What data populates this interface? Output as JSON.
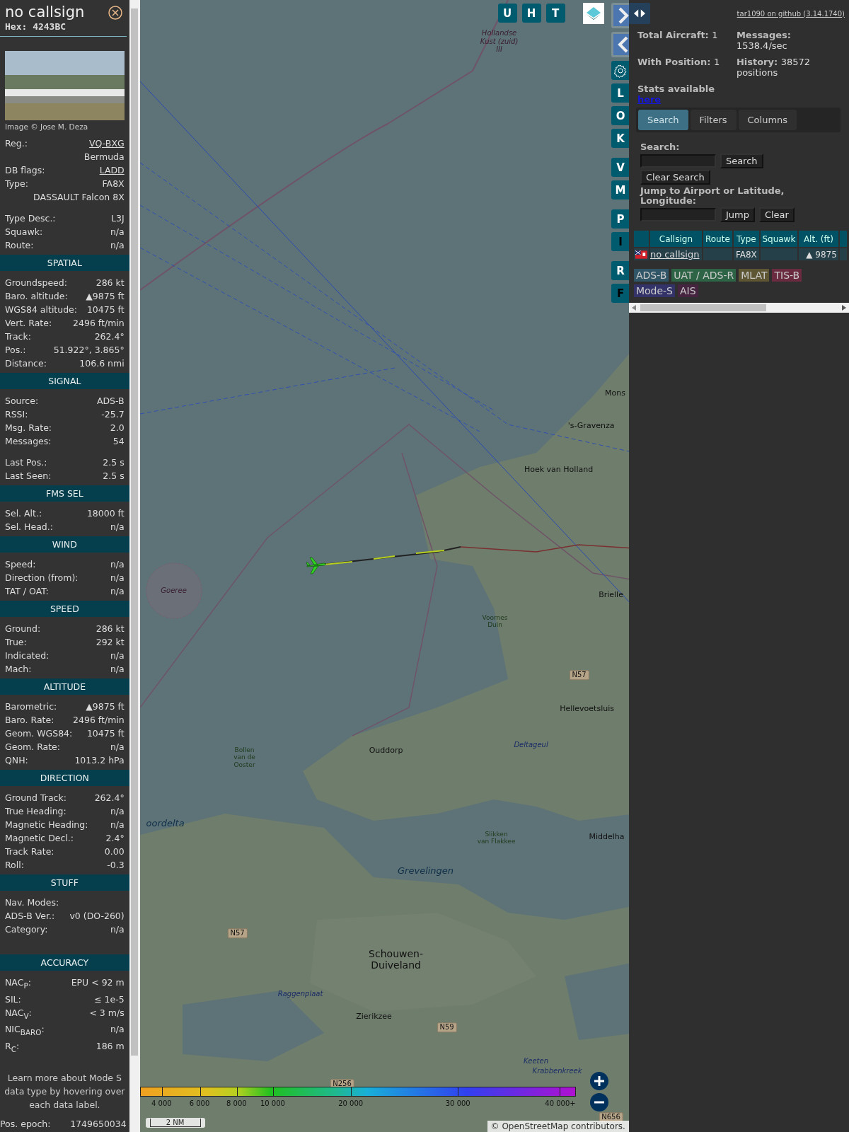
{
  "aircraft_panel": {
    "title": "no callsign",
    "hex": "Hex: 4243BC",
    "photo_credit": "Image © Jose M. Deza",
    "sections": [
      {
        "groups": [
          [
            {
              "label": "Reg.:",
              "value": "VQ-BXG",
              "link": true
            },
            {
              "value": "Bermuda",
              "link": false
            },
            {
              "label": "DB flags:",
              "value": "LADD",
              "link": true
            },
            {
              "label": "Type:",
              "value": "FA8X",
              "link": false
            },
            {
              "value": "DASSAULT Falcon 8X",
              "link": false
            }
          ],
          [
            {
              "label": "Type Desc.:",
              "value": "L3J",
              "link": false
            },
            {
              "label": "Squawk:",
              "value": "n/a",
              "link": false
            },
            {
              "label": "Route:",
              "value": "n/a",
              "link": false
            }
          ]
        ]
      },
      {
        "title": "SPATIAL",
        "groups": [
          [
            {
              "label": "Groundspeed:",
              "value": "286 kt",
              "link": false
            },
            {
              "label": "Baro. altitude:",
              "value": "▲9875 ft",
              "link": false
            },
            {
              "label": "WGS84 altitude:",
              "value": "10475 ft",
              "link": false
            },
            {
              "label": "Vert. Rate:",
              "value": "2496 ft/min",
              "link": false
            },
            {
              "label": "Track:",
              "value": "262.4°",
              "link": false
            },
            {
              "label": "Pos.:",
              "value": "51.922°, 3.865°",
              "link": false
            },
            {
              "label": "Distance:",
              "value": "106.6 nmi",
              "link": false
            }
          ]
        ]
      },
      {
        "title": "SIGNAL",
        "groups": [
          [
            {
              "label": "Source:",
              "value": "ADS-B",
              "link": false
            },
            {
              "label": "RSSI:",
              "value": "-25.7",
              "link": false
            },
            {
              "label": "Msg. Rate:",
              "value": "2.0",
              "link": false
            },
            {
              "label": "Messages:",
              "value": "54",
              "link": false
            }
          ],
          [
            {
              "label": "Last Pos.:",
              "value": "2.5 s",
              "link": false
            },
            {
              "label": "Last Seen:",
              "value": "2.5 s",
              "link": false
            }
          ]
        ]
      },
      {
        "title": "FMS SEL",
        "groups": [
          [
            {
              "label": "Sel. Alt.:",
              "value": "18000 ft",
              "link": false
            },
            {
              "label": "Sel. Head.:",
              "value": "n/a",
              "link": false
            }
          ]
        ]
      },
      {
        "title": "WIND",
        "groups": [
          [
            {
              "label": "Speed:",
              "value": "n/a",
              "link": false
            },
            {
              "label": "Direction (from):",
              "value": "n/a",
              "link": false
            },
            {
              "label": "TAT / OAT:",
              "value": "n/a",
              "link": false
            }
          ]
        ]
      },
      {
        "title": "SPEED",
        "groups": [
          [
            {
              "label": "Ground:",
              "value": "286 kt",
              "link": false
            },
            {
              "label": "True:",
              "value": "292 kt",
              "link": false
            },
            {
              "label": "Indicated:",
              "value": "n/a",
              "link": false
            },
            {
              "label": "Mach:",
              "value": "n/a",
              "link": false
            }
          ]
        ]
      },
      {
        "title": "ALTITUDE",
        "groups": [
          [
            {
              "label": "Barometric:",
              "value": "▲9875 ft",
              "link": false
            },
            {
              "label": "Baro. Rate:",
              "value": "2496 ft/min",
              "link": false
            },
            {
              "label": "Geom. WGS84:",
              "value": "10475 ft",
              "link": false
            },
            {
              "label": "Geom. Rate:",
              "value": "n/a",
              "link": false
            },
            {
              "label": "QNH:",
              "value": "1013.2 hPa",
              "link": false
            }
          ]
        ]
      },
      {
        "title": "DIRECTION",
        "groups": [
          [
            {
              "label": "Ground Track:",
              "value": "262.4°",
              "link": false
            },
            {
              "label": "True Heading:",
              "value": "n/a",
              "link": false
            },
            {
              "label": "Magnetic Heading:",
              "value": "n/a",
              "link": false
            },
            {
              "label": "Magnetic Decl.:",
              "value": "2.4°",
              "link": false
            },
            {
              "label": "Track Rate:",
              "value": "0.00",
              "link": false
            },
            {
              "label": "Roll:",
              "value": "-0.3",
              "link": false
            }
          ]
        ]
      },
      {
        "title": "STUFF",
        "groups": [
          [
            {
              "label": "Nav. Modes:"
            },
            {
              "label": "ADS-B Ver.:",
              "value": "v0 (DO-260)",
              "link": false
            },
            {
              "label": "Category:",
              "value": "n/a",
              "link": false
            }
          ]
        ]
      },
      {
        "title": "ACCURACY",
        "groups": [
          [
            {
              "label": "NAC$_{P}$:",
              "value": "EPU < 92 m",
              "link": false
            },
            {
              "label": "SIL:",
              "value": "≤ 1e-5",
              "link": false
            },
            {
              "label": "NAC$_{V}$:",
              "value": "< 3 m/s",
              "link": false
            },
            {
              "label": "NIC$_{BARO}$:",
              "value": "n/a",
              "link": false
            },
            {
              "label": "R$_{C}$:",
              "value": "186 m",
              "link": false
            }
          ]
        ]
      }
    ],
    "note": "Learn more about Mode S data type by hovering over each data label.",
    "epoch": {
      "label": "Pos. epoch:",
      "value": "1749650034"
    }
  },
  "map": {
    "top_buttons": [
      "U",
      "H",
      "T"
    ],
    "side_buttons": [
      {
        "kind": "arrow-right"
      },
      {
        "kind": "arrow-left"
      },
      {
        "kind": "gear"
      },
      {
        "kind": "letter",
        "label": "L"
      },
      {
        "kind": "letter",
        "label": "O"
      },
      {
        "kind": "letter",
        "label": "K"
      },
      {
        "kind": "letter",
        "label": "V"
      },
      {
        "kind": "letter",
        "label": "M"
      },
      {
        "kind": "letter",
        "label": "P"
      },
      {
        "kind": "letter",
        "label": "I"
      },
      {
        "kind": "letter",
        "label": "R"
      },
      {
        "kind": "letter",
        "label": "F"
      }
    ],
    "labels": [
      {
        "text": "Hollandse\nKust (zuid)\nIII",
        "kind": "area"
      },
      {
        "text": "Mons",
        "kind": "town"
      },
      {
        "text": "'s-Gravenza",
        "kind": "town"
      },
      {
        "text": "Hoek van Holland",
        "kind": "town"
      },
      {
        "text": "Goeree",
        "kind": "area"
      },
      {
        "text": "Brielle",
        "kind": "town"
      },
      {
        "text": "Voornes\nDuin",
        "kind": "nature"
      },
      {
        "text": "N57",
        "kind": "road"
      },
      {
        "text": "Hellevoetsluis",
        "kind": "town"
      },
      {
        "text": "Deltageul",
        "kind": "water"
      },
      {
        "text": "Ouddorp",
        "kind": "town"
      },
      {
        "text": "Bollen\nvan de\nOoster",
        "kind": "nature"
      },
      {
        "text": "Slikken\nvan Flakkee",
        "kind": "nature"
      },
      {
        "text": "Middelha",
        "kind": "town"
      },
      {
        "text": "Grevelingen",
        "kind": "water-big"
      },
      {
        "text": "oordelta",
        "kind": "water-big"
      },
      {
        "text": "N57",
        "kind": "road"
      },
      {
        "text": "Schouwen-\nDuiveland",
        "kind": "island"
      },
      {
        "text": "Raggenplaat",
        "kind": "water"
      },
      {
        "text": "Zierikzee",
        "kind": "town"
      },
      {
        "text": "N59",
        "kind": "road"
      },
      {
        "text": "N256",
        "kind": "road"
      },
      {
        "text": "Keeten",
        "kind": "water"
      },
      {
        "text": "Krabbenkreek",
        "kind": "water"
      },
      {
        "text": "N656",
        "kind": "road"
      }
    ],
    "legend": [
      "4 000",
      "6 000",
      "8 000",
      "10 000",
      "20 000",
      "30 000",
      "40 000+"
    ],
    "scale": "2 NM",
    "attribution": {
      "prefix": "©",
      "link": "OpenStreetMap",
      "suffix": "contributors."
    }
  },
  "side_panel": {
    "github_link": "tar1090 on github (3.14.1740)",
    "stats": [
      {
        "label": "Total Aircraft:",
        "value": "1"
      },
      {
        "label": "Messages:",
        "value": "1538.4/sec"
      },
      {
        "label": "With Position:",
        "value": "1"
      },
      {
        "label": "History:",
        "value": "38572 positions"
      }
    ],
    "stats_note": "Stats available",
    "stats_link": "here",
    "tabs": [
      {
        "label": "Search",
        "selected": true
      },
      {
        "label": "Filters",
        "selected": false
      },
      {
        "label": "Columns",
        "selected": false
      }
    ],
    "search_label": "Search:",
    "search_button": "Search",
    "clear_search_button": "Clear Search",
    "jump_label": "Jump to Airport or Latitude, Longitude:",
    "jump_button": "Jump",
    "clear_button": "Clear",
    "table": {
      "columns": [
        "Callsign",
        "Route",
        "Type",
        "Squawk",
        "Alt. (ft)"
      ],
      "rows": [
        {
          "callsign": "no callsign",
          "type": "FA8X",
          "alt": "▲ 9875"
        }
      ]
    },
    "sources": [
      {
        "label": "ADS-B",
        "color": "#2f5566"
      },
      {
        "label": "UAT / ADS-R",
        "color": "#2d6445"
      },
      {
        "label": "MLAT",
        "color": "#5e5633"
      },
      {
        "label": "TIS-B",
        "color": "#6a2a3f"
      },
      {
        "label": "Mode-S",
        "color": "#33336a"
      },
      {
        "label": "AIS",
        "color": "#45243f"
      }
    ]
  }
}
